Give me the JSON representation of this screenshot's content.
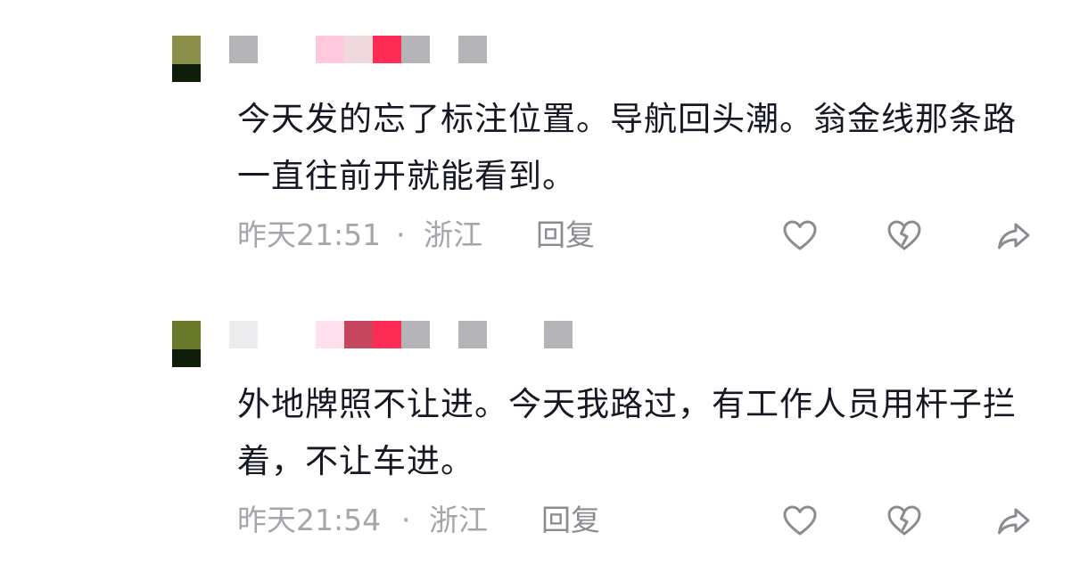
{
  "comments": [
    {
      "avatar_color": "#8a8f4a",
      "name_blocks": [
        "#b3b3b8",
        "#ffc8dc",
        "#f0d9dd",
        "#fe2c55",
        "#b3b3b8",
        "#b3b3b8"
      ],
      "text": "今天发的忘了标注位置。导航回头潮。翁金线那条路一直往前开就能看到。",
      "time": "昨天21:51",
      "separator": "·",
      "location": "浙江",
      "reply_label": "回复",
      "icons": [
        "heart-icon",
        "broken-heart-icon",
        "share-icon"
      ]
    },
    {
      "avatar_color": "#6b7a2a",
      "name_blocks": [
        "#ededf0",
        "#ffe0ee",
        "#c4465f",
        "#fe2c55",
        "#b3b3b8",
        "#b3b3b8",
        "#b3b3b8"
      ],
      "text": "外地牌照不让进。今天我路过，有工作人员用杆子拦着，不让车进。",
      "time": "昨天21:54",
      "separator": "·",
      "location": "浙江",
      "reply_label": "回复",
      "icons": [
        "heart-icon",
        "broken-heart-icon",
        "share-icon"
      ]
    }
  ]
}
